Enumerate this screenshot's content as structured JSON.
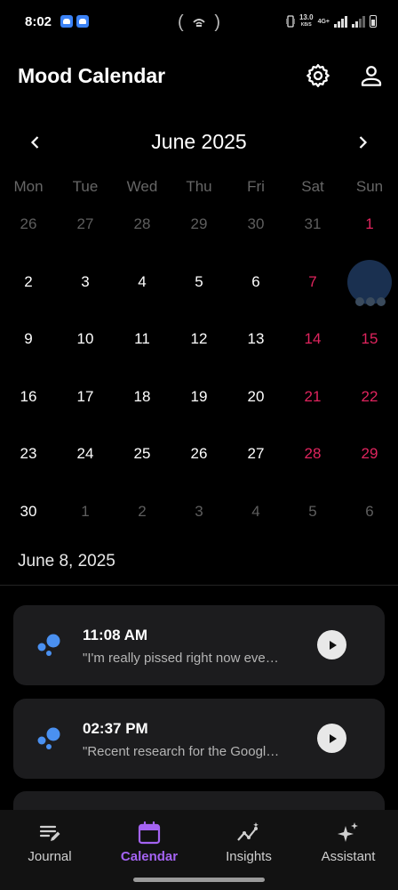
{
  "status": {
    "time": "8:02",
    "speed_value": "13.0",
    "speed_unit": "KB/S",
    "network": "4G+"
  },
  "app": {
    "title": "Mood Calendar",
    "settings_icon": "gear-icon",
    "profile_icon": "person-icon"
  },
  "calendar": {
    "month_label": "June 2025",
    "weekdays": [
      "Mon",
      "Tue",
      "Wed",
      "Thu",
      "Fri",
      "Sat",
      "Sun"
    ],
    "weeks": [
      [
        "26",
        "27",
        "28",
        "29",
        "30",
        "31",
        "1"
      ],
      [
        "2",
        "3",
        "4",
        "5",
        "6",
        "7",
        "8"
      ],
      [
        "9",
        "10",
        "11",
        "12",
        "13",
        "14",
        "15"
      ],
      [
        "16",
        "17",
        "18",
        "19",
        "20",
        "21",
        "22"
      ],
      [
        "23",
        "24",
        "25",
        "26",
        "27",
        "28",
        "29"
      ],
      [
        "30",
        "1",
        "2",
        "3",
        "4",
        "5",
        "6"
      ]
    ],
    "colors": {
      "weekend": "#e0245e",
      "selected": "#1a3050",
      "accent": "#a463f2",
      "mood_dot": "#4a90f0"
    }
  },
  "selected_date": "June 8, 2025",
  "entries": [
    {
      "time": "11:08 AM",
      "text": "\"I'm really pissed right now eve…",
      "icon": "mood-bubbles-icon"
    },
    {
      "time": "02:37 PM",
      "text": "\"Recent research for the Googl…",
      "icon": "mood-bubbles-icon"
    }
  ],
  "nav": [
    {
      "label": "Journal",
      "icon": "journal-icon",
      "active": false
    },
    {
      "label": "Calendar",
      "icon": "calendar-icon",
      "active": true
    },
    {
      "label": "Insights",
      "icon": "insights-icon",
      "active": false
    },
    {
      "label": "Assistant",
      "icon": "sparkle-icon",
      "active": false
    }
  ]
}
